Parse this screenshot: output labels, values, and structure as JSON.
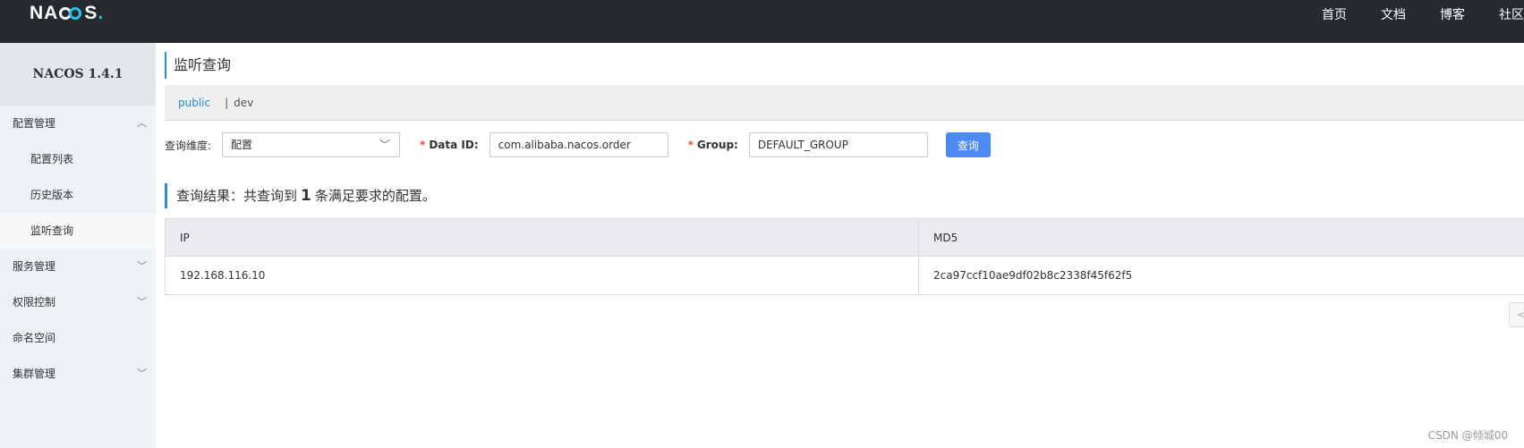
{
  "header": {
    "logo": {
      "left": "NA",
      "right": "S",
      "dot": "."
    },
    "nav": [
      "首页",
      "文档",
      "博客",
      "社区"
    ]
  },
  "sidebar": {
    "title": "NACOS 1.4.1",
    "items": [
      {
        "label": "配置管理",
        "chevron": "chevron-up-icon"
      },
      {
        "label": "配置列表"
      },
      {
        "label": "历史版本"
      },
      {
        "label": "监听查询",
        "active": true
      },
      {
        "label": "服务管理",
        "chevron": "chevron-down-icon"
      },
      {
        "label": "权限控制",
        "chevron": "chevron-down-icon"
      },
      {
        "label": "命名空间"
      },
      {
        "label": "集群管理",
        "chevron": "chevron-down-icon"
      }
    ]
  },
  "main": {
    "title": "监听查询",
    "namespaces": {
      "active": "public",
      "separator": "|",
      "other": "dev"
    },
    "form": {
      "dimension_label": "查询维度:",
      "dimension_value": "配置",
      "required_mark": "*",
      "dataid_label": "Data ID:",
      "dataid_value": "com.alibaba.nacos.order",
      "group_label": "Group:",
      "group_value": "DEFAULT_GROUP",
      "query_button": "查询"
    },
    "result": {
      "prefix": "查询结果：共查询到",
      "count": "1",
      "suffix": "条满足要求的配置。"
    },
    "table": {
      "columns": [
        "IP",
        "MD5"
      ],
      "rows": [
        [
          "192.168.116.10",
          "2ca97ccf10ae9df02b8c2338f45f62f5"
        ]
      ]
    },
    "pager_glyph": "<"
  },
  "watermark": "CSDN @倾城00",
  "colors": {
    "header_bg": "#252a2f",
    "accent": "#2e8bcc",
    "button": "#4e8af6",
    "required": "#e94e3c"
  }
}
